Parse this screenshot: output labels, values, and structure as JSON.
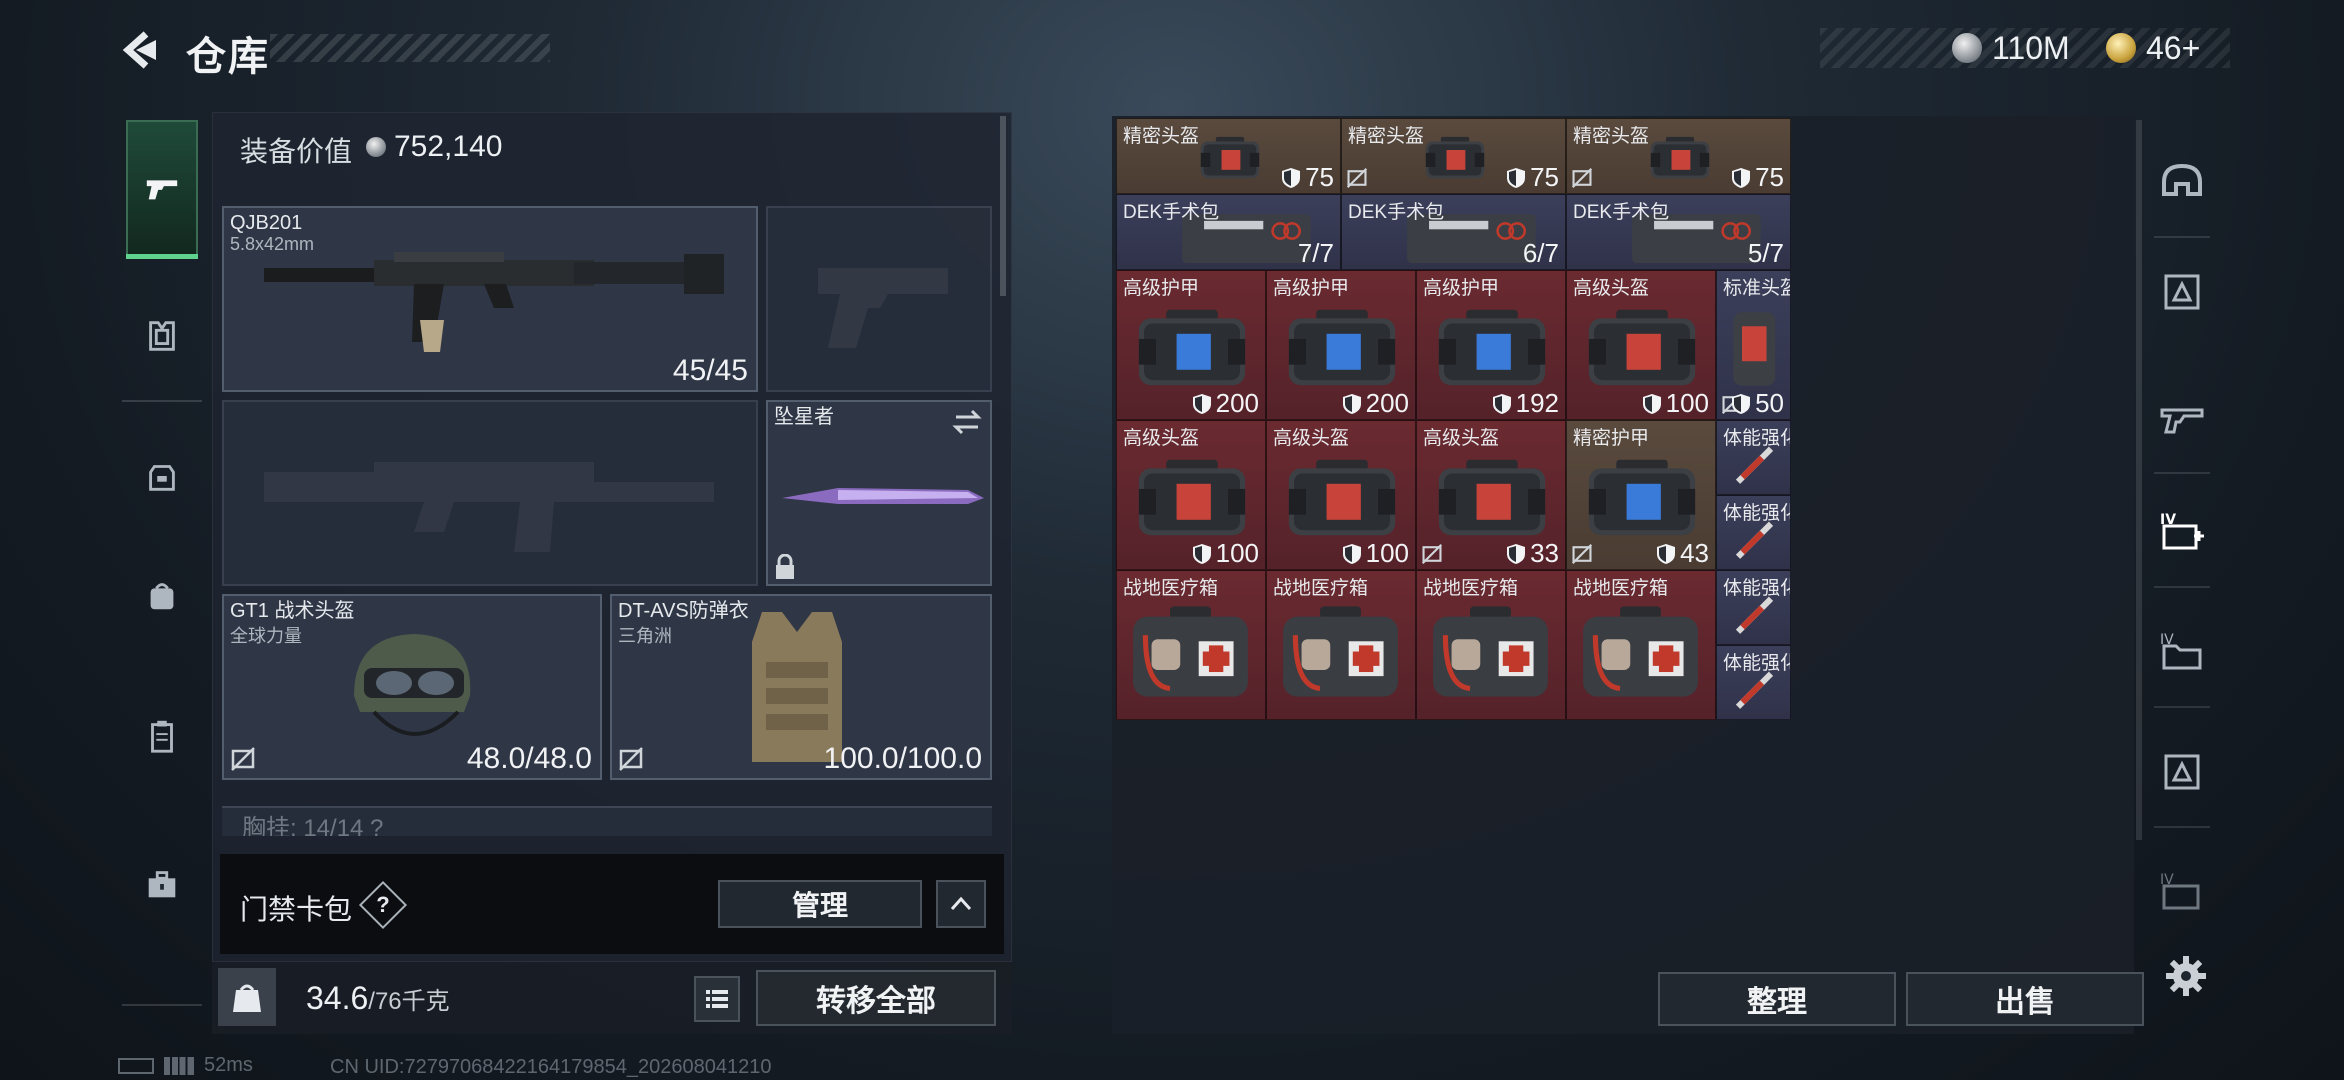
{
  "header": {
    "title": "仓库",
    "currencies": [
      {
        "name": "coin-silver",
        "value": "110M"
      },
      {
        "name": "coin-gold",
        "value": "46+"
      }
    ]
  },
  "left_nav": {
    "items": [
      "weapons-icon",
      "armor-icon",
      "backpack-icon",
      "bag-icon",
      "clipboard-icon",
      "toolbox-icon"
    ]
  },
  "equipment": {
    "value_label": "装备价值",
    "value": "752,140",
    "primary_weapon": {
      "name": "QJB201",
      "ammo": "5.8x42mm",
      "count": "45/45"
    },
    "melee": {
      "name": "坠星者"
    },
    "helmet": {
      "name": "GT1 战术头盔",
      "sub": "全球力量",
      "durability": "48.0/48.0"
    },
    "armor": {
      "name": "DT-AVS防弹衣",
      "sub": "三角洲",
      "durability": "100.0/100.0"
    },
    "vest_strip": "胸挂: 14/14 ?"
  },
  "access_card": {
    "label": "门禁卡包",
    "help": "?",
    "manage_label": "管理"
  },
  "bottom": {
    "weight": "34.6",
    "weight_max": "/76千克",
    "transfer_label": "转移全部",
    "sort_label": "整理",
    "sell_label": "出售"
  },
  "status": {
    "ping": "52ms",
    "uid": "CN UID:72797068422164179854_202608041210"
  },
  "storage": {
    "items": [
      {
        "name": "精密头盔",
        "value": "75"
      },
      {
        "name": "精密头盔",
        "value": "75"
      },
      {
        "name": "精密头盔",
        "value": "75"
      },
      {
        "name": "DEK手术包",
        "value": "7/7"
      },
      {
        "name": "DEK手术包",
        "value": "6/7"
      },
      {
        "name": "DEK手术包",
        "value": "5/7"
      },
      {
        "name": "高级护甲",
        "value": "200"
      },
      {
        "name": "高级护甲",
        "value": "200"
      },
      {
        "name": "高级护甲",
        "value": "192"
      },
      {
        "name": "高级头盔",
        "value": "100"
      },
      {
        "name": "标准头盔",
        "value": "50"
      },
      {
        "name": "高级头盔",
        "value": "100"
      },
      {
        "name": "高级头盔",
        "value": "100"
      },
      {
        "name": "高级头盔",
        "value": "33"
      },
      {
        "name": "精密护甲",
        "value": "43"
      },
      {
        "name": "体能强化剂",
        "value": ""
      },
      {
        "name": "体能强化剂",
        "value": ""
      },
      {
        "name": "战地医疗箱",
        "value": ""
      },
      {
        "name": "战地医疗箱",
        "value": ""
      },
      {
        "name": "战地医疗箱",
        "value": ""
      },
      {
        "name": "战地医疗箱",
        "value": ""
      },
      {
        "name": "体能强化剂",
        "value": ""
      },
      {
        "name": "体能强化剂",
        "value": ""
      }
    ]
  },
  "colors": {
    "accent_green": "#5fd38e",
    "cell_brown": "#5a4a3e",
    "cell_navy": "#3c3f5a",
    "cell_red": "#6a2a30"
  }
}
